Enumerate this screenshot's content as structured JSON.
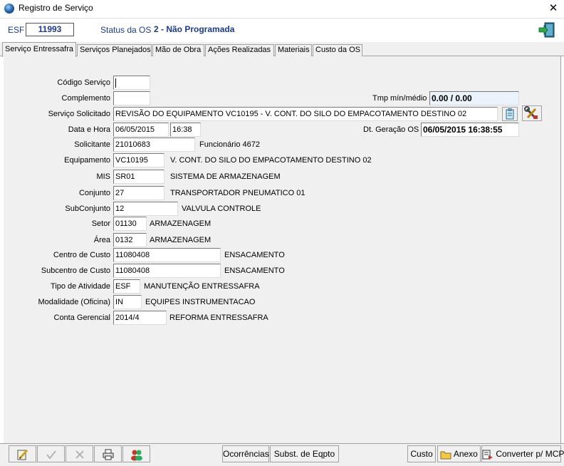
{
  "window": {
    "title": "Registro de Serviço",
    "close_glyph": "✕"
  },
  "header": {
    "esf_label": "ESF",
    "os_number": "11993",
    "status_label": "Status da OS",
    "status_value": "2 - Não Programada"
  },
  "tabs": [
    {
      "label": "Serviço Entressafra",
      "active": true
    },
    {
      "label": "Serviços Planejados"
    },
    {
      "label": "Mão de Obra"
    },
    {
      "label": "Ações Realizadas"
    },
    {
      "label": "Materiais"
    },
    {
      "label": "Custo da OS"
    }
  ],
  "form": {
    "codigo_servico": {
      "label": "Código Serviço",
      "value": ""
    },
    "complemento": {
      "label": "Complemento",
      "value": ""
    },
    "tmp": {
      "label": "Tmp mín/médio",
      "value": "0.00 / 0.00"
    },
    "servico_solicitado": {
      "label": "Serviço Solicitado",
      "value": "REVISÃO DO EQUIPAMENTO VC10195 - V. CONT. DO SILO DO EMPACOTAMENTO DESTINO 02"
    },
    "data_hora": {
      "label": "Data e Hora",
      "date": "06/05/2015",
      "time": "16:38"
    },
    "dt_geracao": {
      "label": "Dt. Geração OS",
      "value": "06/05/2015 16:38:55"
    },
    "solicitante": {
      "label": "Solicitante",
      "value": "21010683",
      "desc": "Funcionário 4672"
    },
    "equipamento": {
      "label": "Equipamento",
      "value": "VC10195",
      "desc": "V. CONT. DO SILO DO EMPACOTAMENTO DESTINO 02"
    },
    "mis": {
      "label": "MIS",
      "value": "SR01",
      "desc": "SISTEMA DE ARMAZENAGEM"
    },
    "conjunto": {
      "label": "Conjunto",
      "value": "27",
      "desc": "TRANSPORTADOR PNEUMATICO 01"
    },
    "subconjunto": {
      "label": "SubConjunto",
      "value": "12",
      "desc": "VALVULA CONTROLE"
    },
    "setor": {
      "label": "Setor",
      "value": "01130",
      "desc": "ARMAZENAGEM"
    },
    "area": {
      "label": "Área",
      "value": "0132",
      "desc": "ARMAZENAGEM"
    },
    "centro_custo": {
      "label": "Centro de Custo",
      "value": "11080408",
      "desc": "ENSACAMENTO"
    },
    "subcentro_custo": {
      "label": "Subcentro de Custo",
      "value": "11080408",
      "desc": "ENSACAMENTO"
    },
    "tipo_atividade": {
      "label": "Tipo de Atividade",
      "value": "ESF",
      "desc": "MANUTENÇÃO  ENTRESSAFRA"
    },
    "modalidade": {
      "label": "Modalidade (Oficina)",
      "value": "IN",
      "desc": "EQUIPES INSTRUMENTACAO"
    },
    "conta_gerencial": {
      "label": "Conta Gerencial",
      "value": "2014/4",
      "desc": "REFORMA ENTRESSAFRA"
    }
  },
  "toolbar": {
    "ocorrencias": "Ocorrências",
    "subst_eqpto": "Subst. de Eqpto",
    "custo": "Custo",
    "anexo": "Anexo",
    "converter": "Converter p/ MCP"
  },
  "icons": {
    "app": "app-globe-icon",
    "exit": "exit-door-icon",
    "clipboard": "clipboard-icon",
    "tools": "tools-icon",
    "edit": "edit-pencil-icon",
    "confirm": "check-icon",
    "cancel": "cancel-x-icon",
    "print": "printer-icon",
    "users": "users-icon",
    "folder": "folder-icon",
    "convert": "convert-icon"
  },
  "colors": {
    "label_blue": "#1a3a8a",
    "panel": "#f0f0f0"
  }
}
